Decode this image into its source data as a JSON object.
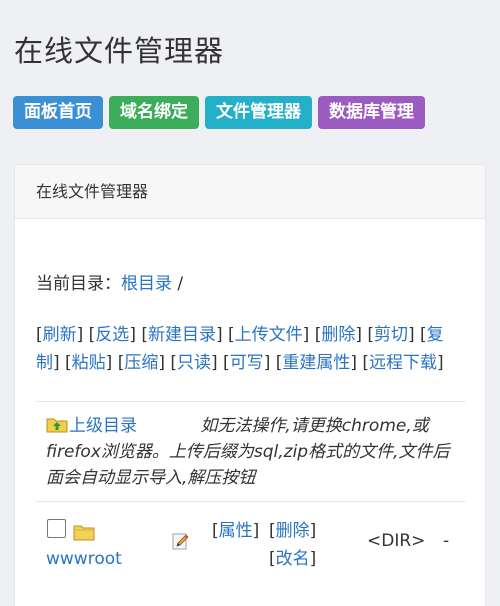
{
  "page_title": "在线文件管理器",
  "nav": [
    {
      "label": "面板首页",
      "color": "#3b8fd4"
    },
    {
      "label": "域名绑定",
      "color": "#3bad5b"
    },
    {
      "label": "文件管理器",
      "color": "#24b0c8"
    },
    {
      "label": "数据库管理",
      "color": "#9b5bc0"
    }
  ],
  "panel": {
    "heading": "在线文件管理器",
    "current_dir_label": "当前目录：",
    "current_dir_link": "根目录",
    "current_dir_suffix": " /",
    "actions": [
      "刷新",
      "反选",
      "新建目录",
      "上传文件",
      "删除",
      "剪切",
      "复制",
      "粘贴",
      "压缩",
      "只读",
      "可写",
      "重建属性",
      "远程下载"
    ],
    "up_label": "上级目录",
    "note": "如无法操作,请更换chrome,或firefox浏览器。上传后缀为sql,zip格式的文件,文件后面会自动显示导入,解压按钮"
  },
  "files": [
    {
      "name": "wwwroot",
      "type": "<DIR>",
      "size": "-",
      "attr_label": "属性",
      "delete_label": "删除",
      "rename_label": "改名"
    }
  ]
}
